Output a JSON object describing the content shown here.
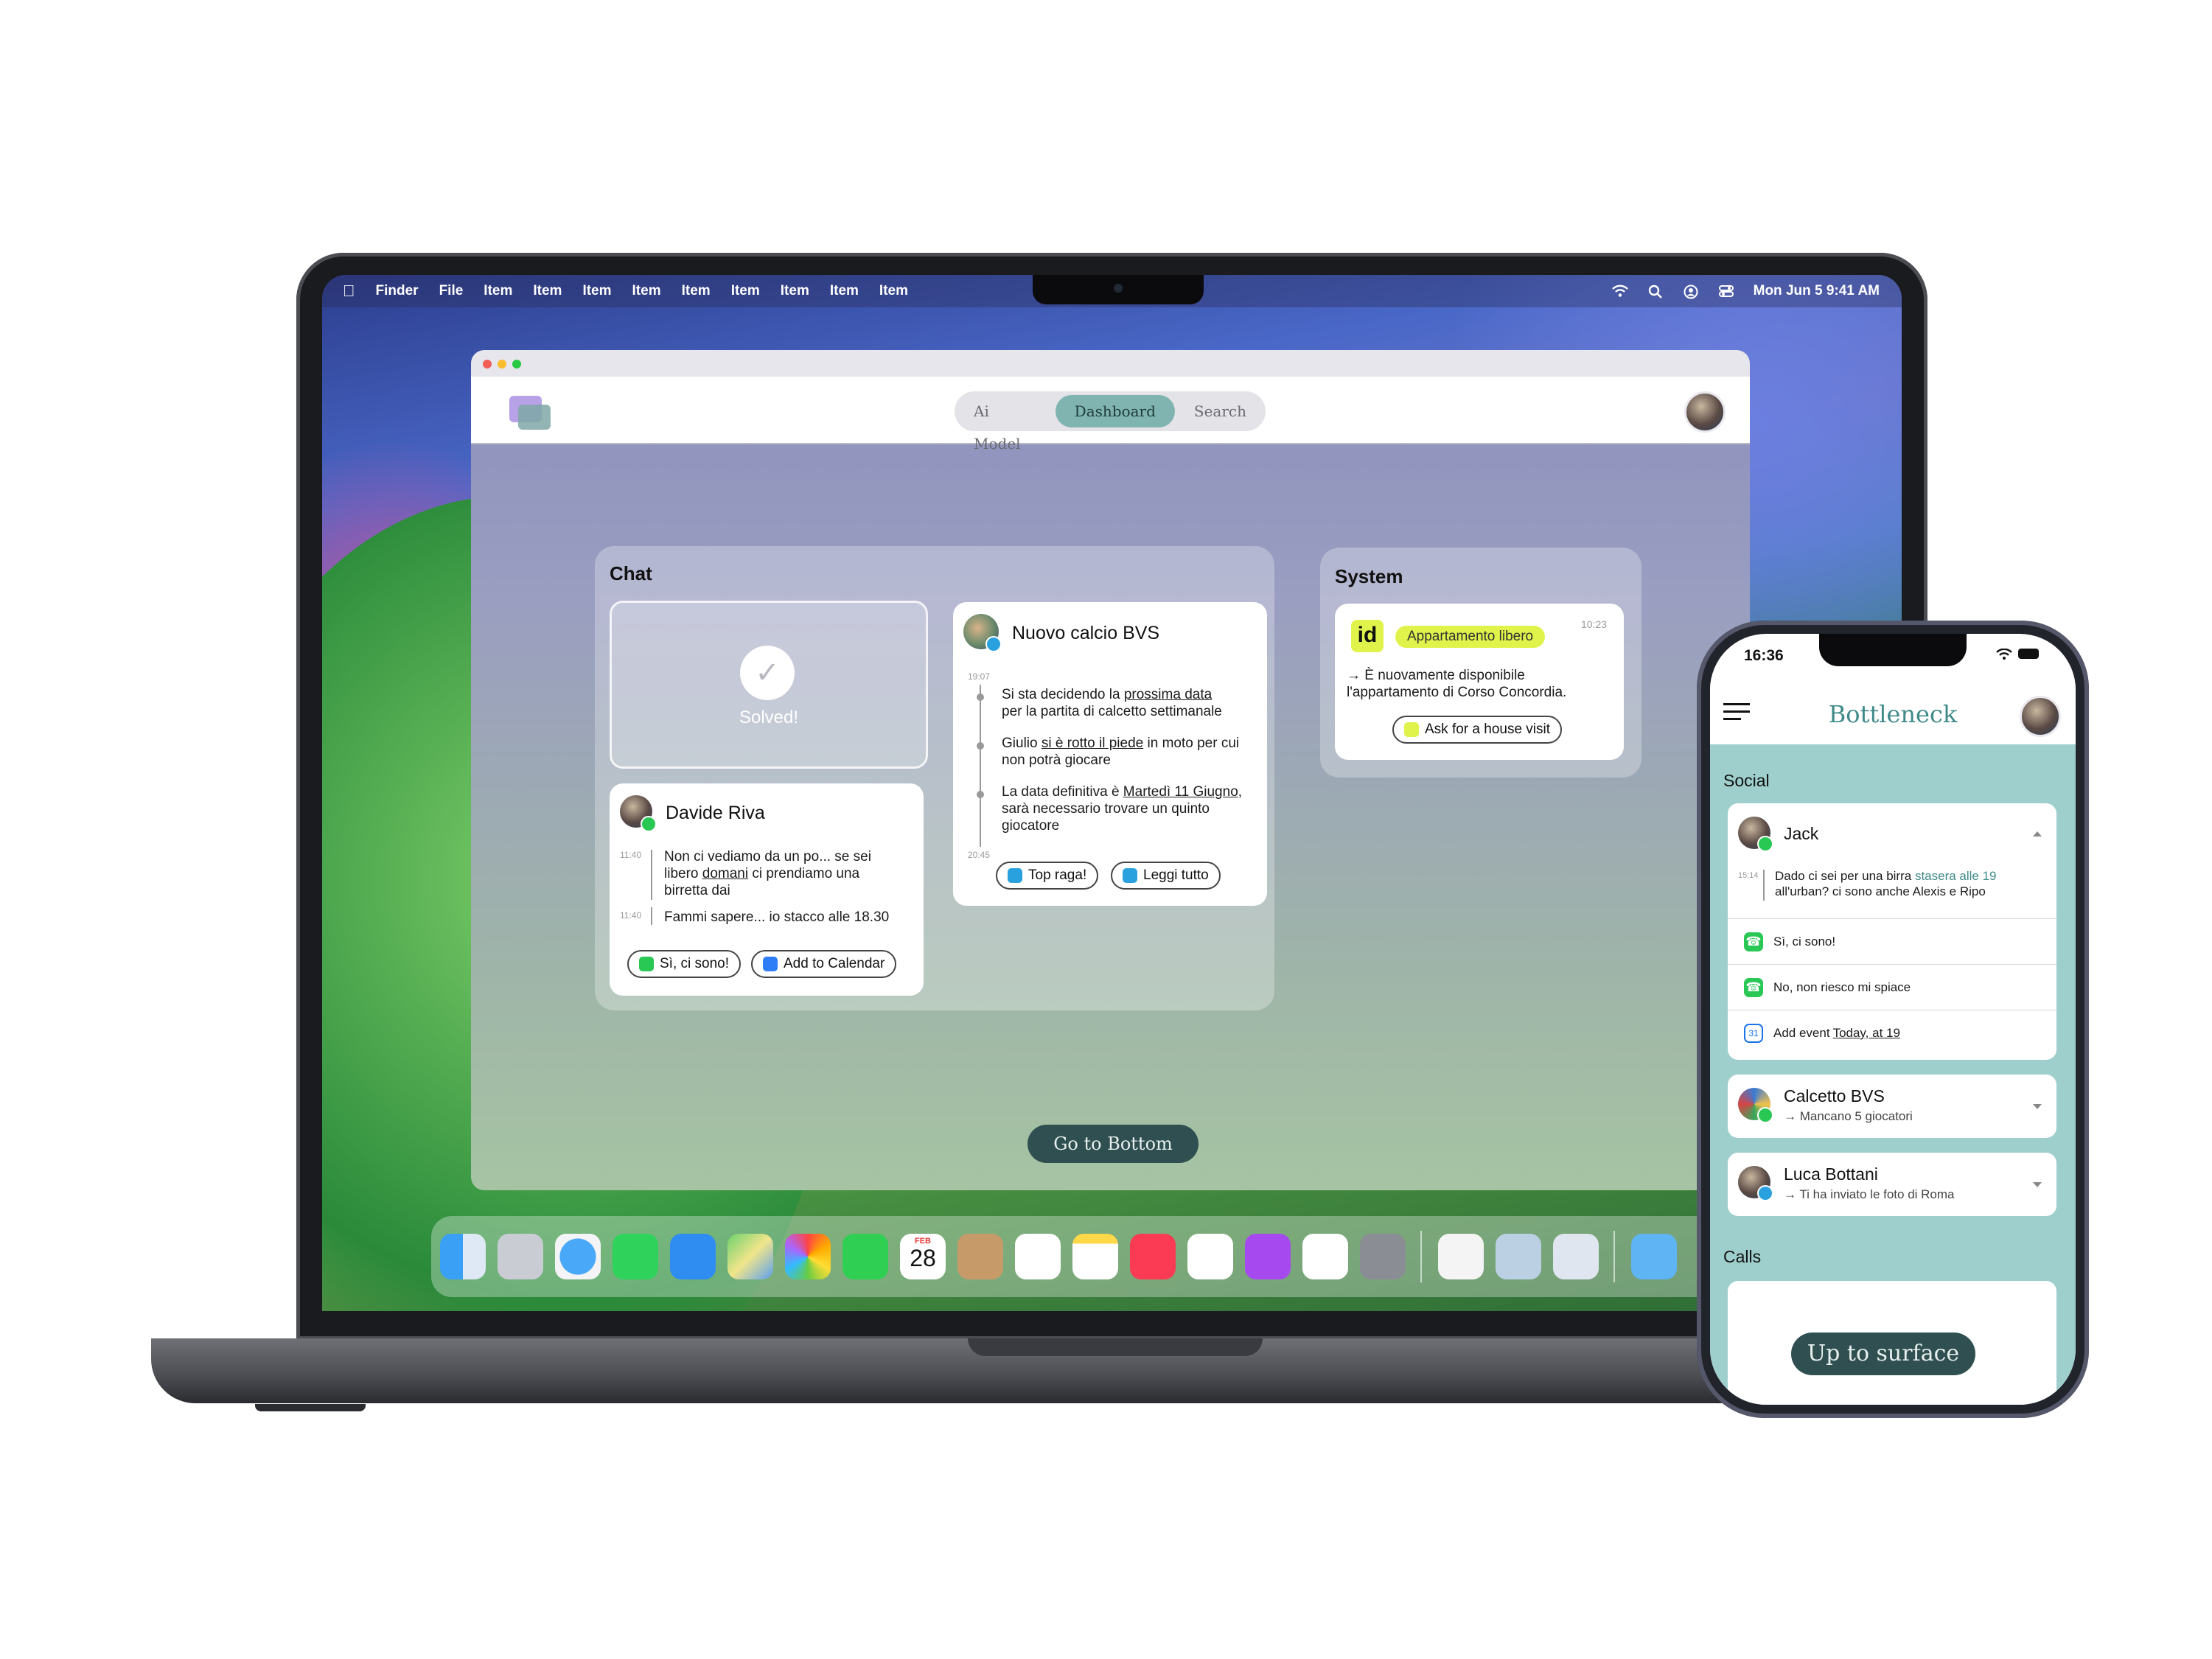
{
  "menubar": {
    "app": "Finder",
    "items": [
      "File",
      "Item",
      "Item",
      "Item",
      "Item",
      "Item",
      "Item",
      "Item",
      "Item",
      "Item"
    ],
    "clock": "Mon Jun 5  9:41 AM"
  },
  "app": {
    "tabs": [
      "Ai Model",
      "Dashboard",
      "Search"
    ],
    "active_tab": "Dashboard",
    "chat": {
      "title": "Chat",
      "solved_label": "Solved!",
      "davide": {
        "name": "Davide Riva",
        "time1": "11:40",
        "msg1_a": "Non ci vediamo da un po... se sei",
        "msg1_b": "libero ",
        "msg1_link": "domani",
        "msg1_c": " ci prendiamo una",
        "msg1_d": "birretta dai",
        "time2": "11:40",
        "msg2": "Fammi sapere... io stacco alle 18.30",
        "btn1": "Sì, ci sono!",
        "btn2": "Add to Calendar"
      },
      "calcio": {
        "name": "Nuovo calcio BVS",
        "time_start": "19:07",
        "time_end": "20:45",
        "m1_a": "Si sta decidendo la ",
        "m1_link": "prossima data",
        "m1_b": "per la partita di calcetto settimanale",
        "m2_a": "Giulio ",
        "m2_link": "si è rotto il piede",
        "m2_b": " in moto per cui",
        "m2_c": "non potrà giocare",
        "m3_a": "La data definitiva è ",
        "m3_link": "Martedì 11 Giugno",
        "m3_b": ",",
        "m3_c": "sarà necessario trovare un quinto",
        "m3_d": "giocatore",
        "btn1": "Top raga!",
        "btn2": "Leggi tutto"
      }
    },
    "system": {
      "title": "System",
      "badge": "Appartamento libero",
      "time": "10:23",
      "logo_text": "id",
      "msg_a": "→ È nuovamente disponibile",
      "msg_b": "l'appartamento di Corso Concordia.",
      "btn": "Ask for a house visit"
    },
    "goto_bottom": "Go to Bottom"
  },
  "dock": {
    "calendar_month": "FEB",
    "calendar_day": "28"
  },
  "phone": {
    "time": "16:36",
    "title": "Bottleneck",
    "social_title": "Social",
    "jack": {
      "name": "Jack",
      "time": "15:14",
      "msg_a": "Dado ci sei per una birra ",
      "msg_link": "stasera alle 19",
      "msg_b": "all'urban? ci sono anche Alexis e Ripo",
      "opt1": "Sì, ci sono!",
      "opt2": "No, non riesco mi spiace",
      "opt3_a": "Add event ",
      "opt3_link": "Today, at 19",
      "cal_day": "31"
    },
    "calcetto": {
      "name": "Calcetto BVS",
      "sub": "→ Mancano 5 giocatori"
    },
    "luca": {
      "name": "Luca Bottani",
      "sub": "→ Ti ha inviato le foto di Roma"
    },
    "calls_title": "Calls",
    "up_surface": "Up to surface"
  }
}
